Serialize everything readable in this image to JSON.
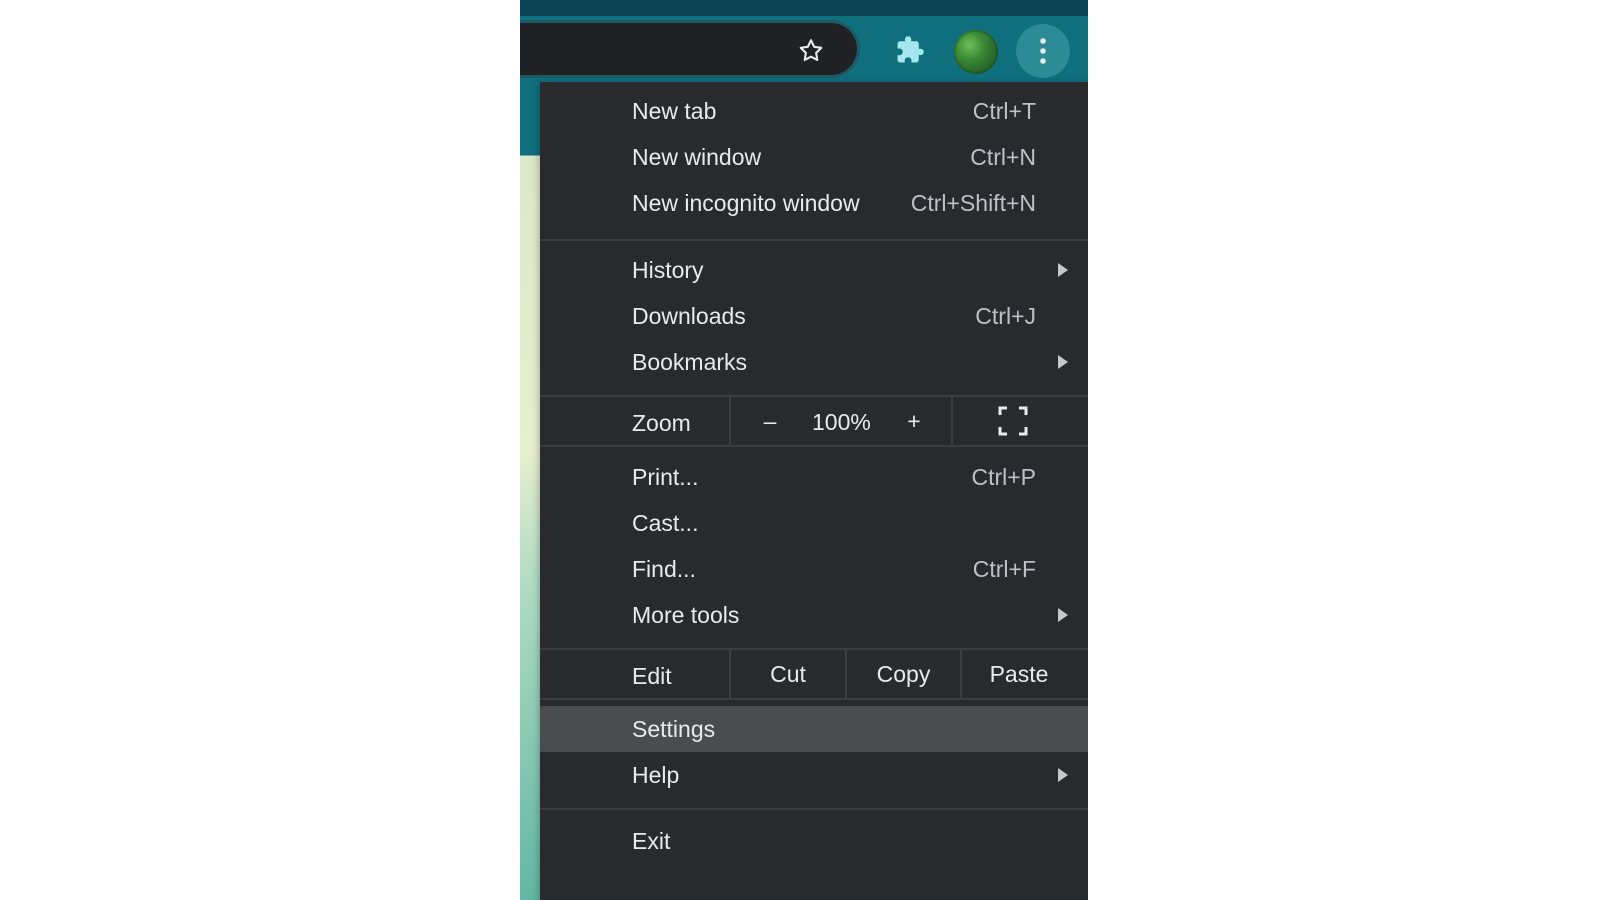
{
  "menu": {
    "new_tab": {
      "label": "New tab",
      "shortcut": "Ctrl+T"
    },
    "new_window": {
      "label": "New window",
      "shortcut": "Ctrl+N"
    },
    "new_incognito": {
      "label": "New incognito window",
      "shortcut": "Ctrl+Shift+N"
    },
    "history": {
      "label": "History"
    },
    "downloads": {
      "label": "Downloads",
      "shortcut": "Ctrl+J"
    },
    "bookmarks": {
      "label": "Bookmarks"
    },
    "zoom": {
      "label": "Zoom",
      "minus": "–",
      "value": "100%",
      "plus": "+"
    },
    "print": {
      "label": "Print...",
      "shortcut": "Ctrl+P"
    },
    "cast": {
      "label": "Cast..."
    },
    "find": {
      "label": "Find...",
      "shortcut": "Ctrl+F"
    },
    "more_tools": {
      "label": "More tools"
    },
    "edit": {
      "label": "Edit",
      "cut": "Cut",
      "copy": "Copy",
      "paste": "Paste"
    },
    "settings": {
      "label": "Settings"
    },
    "help": {
      "label": "Help"
    },
    "exit": {
      "label": "Exit"
    }
  },
  "icons": {
    "star": "star-icon",
    "extensions": "puzzle-icon",
    "avatar": "avatar",
    "kebab": "more-vertical-icon",
    "fullscreen": "fullscreen-icon",
    "submenu": "chevron-right-icon"
  }
}
